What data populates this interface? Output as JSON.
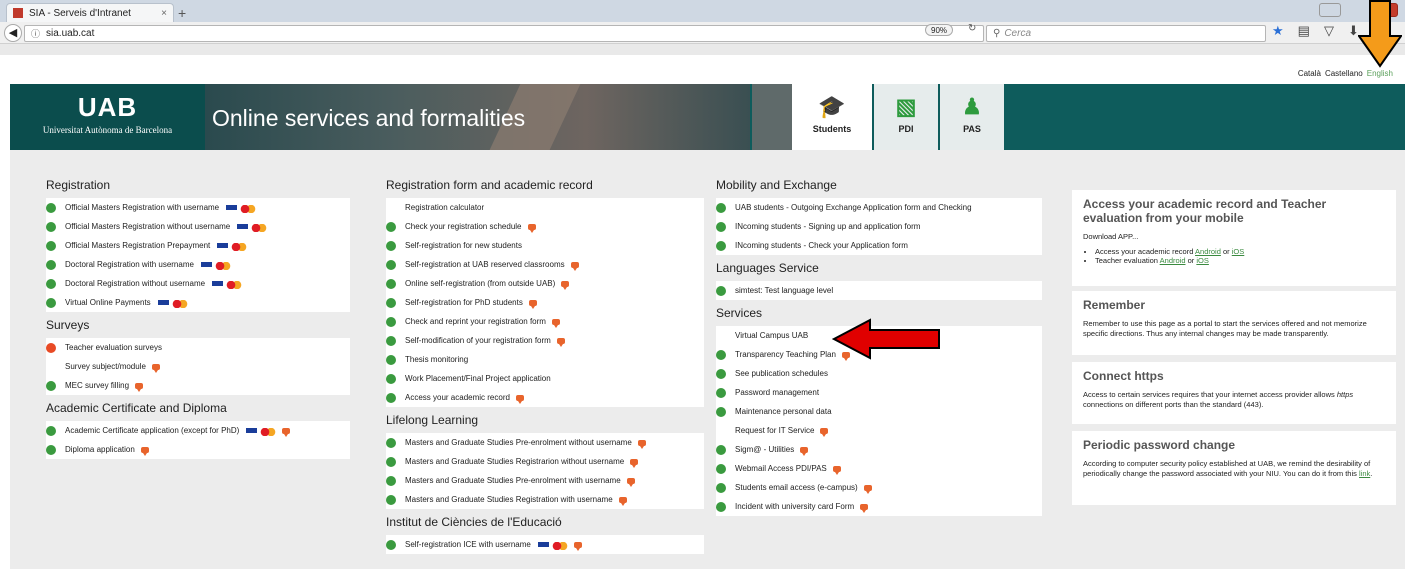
{
  "browser": {
    "tab_title": "SIA - Serveis d'Intranet",
    "tab_close": "×",
    "new_tab": "+",
    "url": "sia.uab.cat",
    "zoom": "90%",
    "search_placeholder": "Cerca"
  },
  "languages": [
    "Català",
    "Castellano",
    "English"
  ],
  "header": {
    "logo_big": "UAB",
    "logo_small": "Universitat Autònoma de Barcelona",
    "title": "Online services and formalities",
    "tabs": [
      "Students",
      "PDI",
      "PAS"
    ]
  },
  "columns": [
    {
      "sections": [
        {
          "title": "Registration",
          "items": [
            {
              "label": "Official Masters Registration with username",
              "dot": "g",
              "card": true,
              "chat": false
            },
            {
              "label": "Official Masters Registration without username",
              "dot": "g",
              "card": true,
              "chat": false
            },
            {
              "label": "Official Masters Registration Prepayment",
              "dot": "g",
              "card": true,
              "chat": false
            },
            {
              "label": "Doctoral Registration with username",
              "dot": "g",
              "card": true,
              "chat": false
            },
            {
              "label": "Doctoral Registration without username",
              "dot": "g",
              "card": true,
              "chat": false
            },
            {
              "label": "Virtual Online Payments",
              "dot": "g",
              "card": true,
              "chat": false
            }
          ]
        },
        {
          "title": "Surveys",
          "items": [
            {
              "label": "Teacher evaluation surveys",
              "dot": "r",
              "card": false,
              "chat": false
            },
            {
              "label": "Survey subject/module",
              "dot": "n",
              "card": false,
              "chat": true
            },
            {
              "label": "MEC survey filling",
              "dot": "g",
              "card": false,
              "chat": true
            }
          ]
        },
        {
          "title": "Academic Certificate and Diploma",
          "items": [
            {
              "label": "Academic Certificate application (except for PhD)",
              "dot": "g",
              "card": true,
              "chat": true
            },
            {
              "label": "Diploma application",
              "dot": "g",
              "card": false,
              "chat": true
            }
          ]
        }
      ]
    },
    {
      "sections": [
        {
          "title": "Registration form and academic record",
          "items": [
            {
              "label": "Registration calculator",
              "dot": "n",
              "card": false,
              "chat": false
            },
            {
              "label": "Check your registration schedule",
              "dot": "g",
              "card": false,
              "chat": true
            },
            {
              "label": "Self-registration for new students",
              "dot": "g",
              "card": false,
              "chat": false
            },
            {
              "label": "Self-registration at UAB reserved classrooms",
              "dot": "g",
              "card": false,
              "chat": true
            },
            {
              "label": "Online self-registration (from outside UAB)",
              "dot": "g",
              "card": false,
              "chat": true
            },
            {
              "label": "Self-registration for PhD students",
              "dot": "g",
              "card": false,
              "chat": true
            },
            {
              "label": "Check and reprint your registration form",
              "dot": "g",
              "card": false,
              "chat": true
            },
            {
              "label": "Self-modification of your registration form",
              "dot": "g",
              "card": false,
              "chat": true
            },
            {
              "label": "Thesis monitoring",
              "dot": "g",
              "card": false,
              "chat": false
            },
            {
              "label": "Work Placement/Final Project application",
              "dot": "g",
              "card": false,
              "chat": false
            },
            {
              "label": "Access your academic record",
              "dot": "g",
              "card": false,
              "chat": true
            }
          ]
        },
        {
          "title": "Lifelong Learning",
          "items": [
            {
              "label": "Masters and Graduate Studies Pre-enrolment without username",
              "dot": "g",
              "card": false,
              "chat": true
            },
            {
              "label": "Masters and Graduate Studies Registrarion without username",
              "dot": "g",
              "card": false,
              "chat": true
            },
            {
              "label": "Masters and Graduate Studies Pre-enrolment with username",
              "dot": "g",
              "card": false,
              "chat": true
            },
            {
              "label": "Masters and Graduate Studies Registration with username",
              "dot": "g",
              "card": false,
              "chat": true
            }
          ]
        },
        {
          "title": "Institut de Ciències de l'Educació",
          "items": [
            {
              "label": "Self-registration ICE with username",
              "dot": "g",
              "card": true,
              "chat": true
            }
          ]
        }
      ]
    },
    {
      "sections": [
        {
          "title": "Mobility and Exchange",
          "items": [
            {
              "label": "UAB students - Outgoing Exchange Application form and Checking",
              "dot": "g",
              "card": false,
              "chat": false
            },
            {
              "label": "INcoming students - Signing up and application form",
              "dot": "g",
              "card": false,
              "chat": false
            },
            {
              "label": "INcoming students - Check your Application form",
              "dot": "g",
              "card": false,
              "chat": false
            }
          ]
        },
        {
          "title": "Languages Service",
          "items": [
            {
              "label": "simtest: Test language level",
              "dot": "g",
              "card": false,
              "chat": false
            }
          ]
        },
        {
          "title": "Services",
          "items": [
            {
              "label": "Virtual Campus UAB",
              "dot": "n",
              "card": false,
              "chat": false
            },
            {
              "label": "Transparency Teaching Plan",
              "dot": "g",
              "card": false,
              "chat": true
            },
            {
              "label": "See publication schedules",
              "dot": "g",
              "card": false,
              "chat": false
            },
            {
              "label": "Password management",
              "dot": "g",
              "card": false,
              "chat": false
            },
            {
              "label": "Maintenance personal data",
              "dot": "g",
              "card": false,
              "chat": false
            },
            {
              "label": "Request for IT Service",
              "dot": "n",
              "card": false,
              "chat": true
            },
            {
              "label": "Sigm@ - Utilities",
              "dot": "g",
              "card": false,
              "chat": true
            },
            {
              "label": "Webmail Access PDI/PAS",
              "dot": "g",
              "card": false,
              "chat": true
            },
            {
              "label": "Students email access (e-campus)",
              "dot": "g",
              "card": false,
              "chat": true
            },
            {
              "label": "Incident with university card Form",
              "dot": "g",
              "card": false,
              "chat": true
            }
          ]
        }
      ]
    }
  ],
  "panels": {
    "mobile": {
      "title": "Access your academic record and Teacher evaluation from your mobile",
      "lead": "Download APP...",
      "line1_prefix": "Access your academic record",
      "line1_android": "Android",
      "or": "or",
      "line1_ios": "iOS",
      "line2_prefix": "Teacher evaluation",
      "line2_android": "Android",
      "line2_ios": "iOS"
    },
    "remember": {
      "title": "Remember",
      "text": "Remember to use this page as a portal to start the services offered and not memorize specific directions. Thus any internal changes may be made transparently."
    },
    "https": {
      "title": "Connect https",
      "text_a": "Access to certain services requires that your internet access provider allows",
      "https_word": "https",
      "text_b": "connections on different ports than the standard (443)."
    },
    "password": {
      "title": "Periodic password change",
      "text": "According to computer security policy established at UAB, we remind the desirability of periodically change the password associated with your NIU. You can do it from this",
      "link": "link",
      "end": "."
    }
  },
  "colors": {
    "teal": "#0e5c5c",
    "green_dot": "#3a9a3f",
    "red_dot": "#e84a25",
    "arrow_red": "#e00000",
    "arrow_orange": "#f49b1a"
  }
}
